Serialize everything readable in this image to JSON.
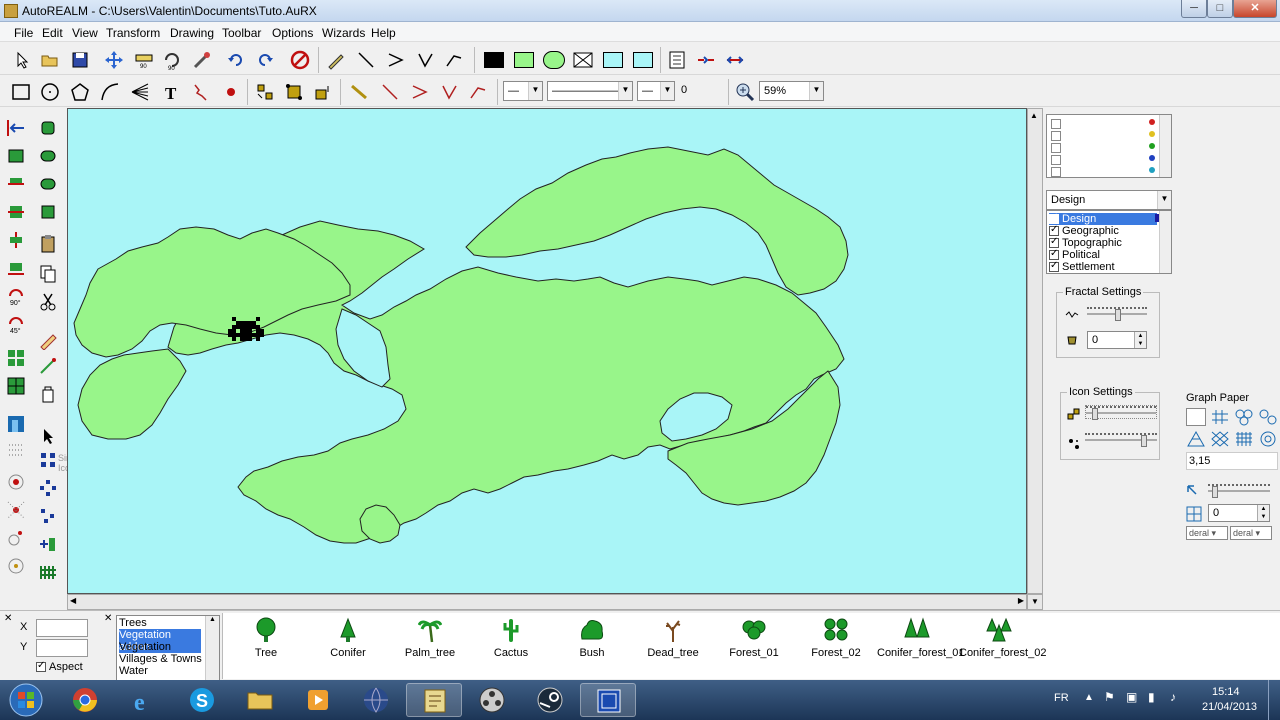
{
  "window": {
    "title": "AutoREALM - C:\\Users\\Valentin\\Documents\\Tuto.AuRX",
    "minimize": "─",
    "maximize": "□",
    "close": "✕"
  },
  "menu": [
    "File",
    "Edit",
    "View",
    "Transform",
    "Drawing",
    "Toolbar",
    "Options",
    "Wizards",
    "Help"
  ],
  "toolbar2": {
    "line_width_value": "0",
    "zoom_value": "59%"
  },
  "tooltip": "Single Icon",
  "right_panel": {
    "overlay_dropdown": "Design",
    "overlays": [
      {
        "label": "Design",
        "checked": true,
        "selected": true
      },
      {
        "label": "Geographic",
        "checked": true,
        "selected": false
      },
      {
        "label": "Topographic",
        "checked": true,
        "selected": false
      },
      {
        "label": "Political",
        "checked": true,
        "selected": false
      },
      {
        "label": "Settlement",
        "checked": true,
        "selected": false
      }
    ],
    "fractal_settings_title": "Fractal Settings",
    "fractal_value": "0",
    "icon_settings_title": "Icon Settings",
    "graph_paper_title": "Graph Paper",
    "graph_scale": "3,15",
    "grid_value": "0",
    "grid_dropdown_1": "deral",
    "grid_dropdown_2": "deral"
  },
  "coords": {
    "x_label": "X",
    "y_label": "Y",
    "aspect_label": "Aspect",
    "x_value": "",
    "y_value": ""
  },
  "icon_categories": [
    "Trees",
    "Vegetation addon",
    "Vegetation",
    "Villages & Towns",
    "Water"
  ],
  "icon_categories_selected": "Vegetation addon",
  "icons": [
    "Tree",
    "Conifer",
    "Palm_tree",
    "Cactus",
    "Bush",
    "Dead_tree",
    "Forest_01",
    "Forest_02",
    "Conifer_forest_01",
    "Conifer_forest_02"
  ],
  "taskbar": {
    "language": "FR",
    "time": "15:14",
    "date": "21/04/2013"
  },
  "colors": {
    "sea": "#a9f5f7",
    "land": "#98f58a",
    "coast": "#222222",
    "tree_green": "#1c9a2a"
  }
}
